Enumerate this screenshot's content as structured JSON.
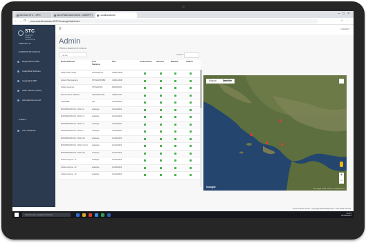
{
  "browser": {
    "tabs": [
      {
        "label": "Servizio STC - SPC"
      },
      {
        "label": "Area Riservata Clienti - GARIPT I"
      },
      {
        "label": "Localizzazione"
      }
    ],
    "url": "www.smartsharnesstc.it/STCH/manage/dashboard"
  },
  "sidebar": {
    "logo": "STC",
    "logo_sub": "STAZIONI TERMO CLIMATICHE",
    "user": "CIRCOLO 17",
    "section": "AMMINISTRAZIONE",
    "items": [
      {
        "label": "Registrazione SBS",
        "icon": "register-icon"
      },
      {
        "label": "Anagrafica Stazione",
        "icon": "station-icon"
      },
      {
        "label": "Anagrafica SBS",
        "icon": "list-icon"
      },
      {
        "label": "Stato Stazioni (GMT)",
        "icon": "status-icon"
      },
      {
        "label": "Aziendazione servizi",
        "icon": "service-icon"
      },
      {
        "label": "UTENTI",
        "icon": "users-icon"
      },
      {
        "label": "Anni Scolastici",
        "icon": "calendar-icon"
      }
    ]
  },
  "topbar": {
    "logout": "LOGOUT"
  },
  "page": {
    "title": "Admin",
    "subtitle": "Elenco stazioni di misura",
    "filter": "All att",
    "search_label": "Search:",
    "footer_left": "Items 14 - Lorem Footer List",
    "footer_right": "Smart Tracker Centro - Copyright 2019 Rasgemonti - Tutti i diritti riservati"
  },
  "table": {
    "headers": [
      "Nome Stazione",
      "Cod. Stazione",
      "Sito",
      "Connessione",
      "Sensore",
      "Batteria",
      "Allarmi"
    ],
    "rows": [
      {
        "name": "Istituto ISIS Cerullo",
        "code": "STNSA20LCT",
        "site": "ISAML20000"
      },
      {
        "name": "Istituto ISSA Lagrana",
        "code": "STNSA2TRMBR",
        "site": "ISAML20000"
      },
      {
        "name": "Istituto Ampere 1",
        "code": "STNSA2TRA",
        "site": "PIMA0002N"
      },
      {
        "name": "Rocca Cilento Sabatino",
        "code": "STNSA2TSTLE",
        "site": "ISAML001P"
      },
      {
        "name": "GAVATIER",
        "code": "test",
        "site": "GAFAL0001"
      },
      {
        "name": "MONTEPERTUSO - BOLO 1",
        "code": "autologie",
        "site": "GAFAL0001"
      },
      {
        "name": "MONTEPERTUSO - BOLO 3",
        "code": "autologie",
        "site": "GAFAL0001"
      },
      {
        "name": "MONTEPERTUSO - BOLO 5",
        "code": "autologie",
        "site": "GAFAL0001"
      },
      {
        "name": "MONTEPERTUSO - BOLO 7",
        "code": "autologie",
        "site": "GAFAL0001"
      },
      {
        "name": "MONTEPERTUSO - BOLO 10",
        "code": "autologie",
        "site": "GAFAL0001"
      },
      {
        "name": "MONTEPERTUSO - BOLO 11 (3)",
        "code": "autologie",
        "site": "GAFAL0001"
      },
      {
        "name": "MONTEPERTUSO - BOLO 12",
        "code": "autologie",
        "site": "GAFAL0001"
      },
      {
        "name": "Istituto Ampere - 11",
        "code": "autologie",
        "site": "GAFAL0001"
      },
      {
        "name": "Istituto Ampere - 12",
        "code": "autologie",
        "site": "GAFAL0001"
      },
      {
        "name": "Istituto Ampere - 13",
        "code": "autologie",
        "site": "GAFAL0001"
      }
    ]
  },
  "map": {
    "tab_map": "Mappa",
    "tab_satellite": "Satellite",
    "zoom_in": "+",
    "zoom_out": "−",
    "brand": "Google",
    "copyright": "Dati mappa ©2019 · Termini e condizioni d'uso"
  },
  "taskbar": {
    "search_placeholder": "Scrivi qui per eseguire la ricerca",
    "time": "12:15",
    "date": "13/09/2019"
  },
  "colors": {
    "sidebar": "#2b3a4e",
    "status_ok": "#4caf50",
    "bezel": "#262626"
  }
}
